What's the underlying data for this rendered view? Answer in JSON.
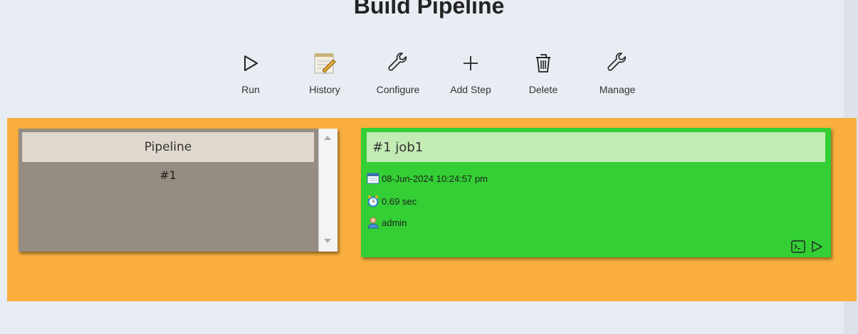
{
  "page": {
    "title": "Build Pipeline"
  },
  "toolbar": {
    "items": [
      {
        "label": "Run",
        "icon": "play-icon"
      },
      {
        "label": "History",
        "icon": "notepad-icon"
      },
      {
        "label": "Configure",
        "icon": "wrench-icon"
      },
      {
        "label": "Add Step",
        "icon": "plus-icon"
      },
      {
        "label": "Delete",
        "icon": "trash-icon"
      },
      {
        "label": "Manage",
        "icon": "wrench-icon"
      }
    ]
  },
  "pipeline_panel": {
    "header": "Pipeline",
    "rows": [
      "#1"
    ]
  },
  "job_card": {
    "title": "#1 job1",
    "date": "08-Jun-2024 10:24:57 pm",
    "duration": "0.69 sec",
    "user": "admin",
    "status_color": "#33cf34",
    "actions": [
      "console-icon",
      "play-icon"
    ]
  },
  "colors": {
    "band": "#f9ae3e",
    "panel": "#968d82",
    "background": "#e8ecf3"
  }
}
